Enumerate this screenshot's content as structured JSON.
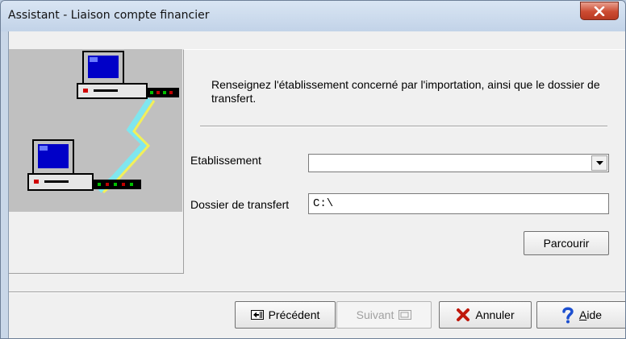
{
  "window": {
    "title": "Assistant - Liaison compte financier"
  },
  "form": {
    "intro": "Renseignez l'établissement concerné par l'importation, ainsi que le dossier de transfert.",
    "etablissement_label": "Etablissement",
    "etablissement_value": "",
    "dossier_label": "Dossier de transfert",
    "dossier_value": "C:\\",
    "browse_label": "Parcourir"
  },
  "buttons": {
    "previous": "Précédent",
    "next": "Suivant",
    "cancel": "Annuler",
    "help_prefix": "A",
    "help_rest": "ide"
  },
  "colors": {
    "close_button": "#cc4b32",
    "cancel_x": "#c0180c",
    "help_question": "#1c4fd0"
  },
  "icons": {
    "illustration": "network-computers-icon",
    "close": "close-icon",
    "previous": "arrow-left-icon",
    "next": "arrow-right-icon",
    "cancel": "red-x-icon",
    "help": "question-mark-icon"
  }
}
